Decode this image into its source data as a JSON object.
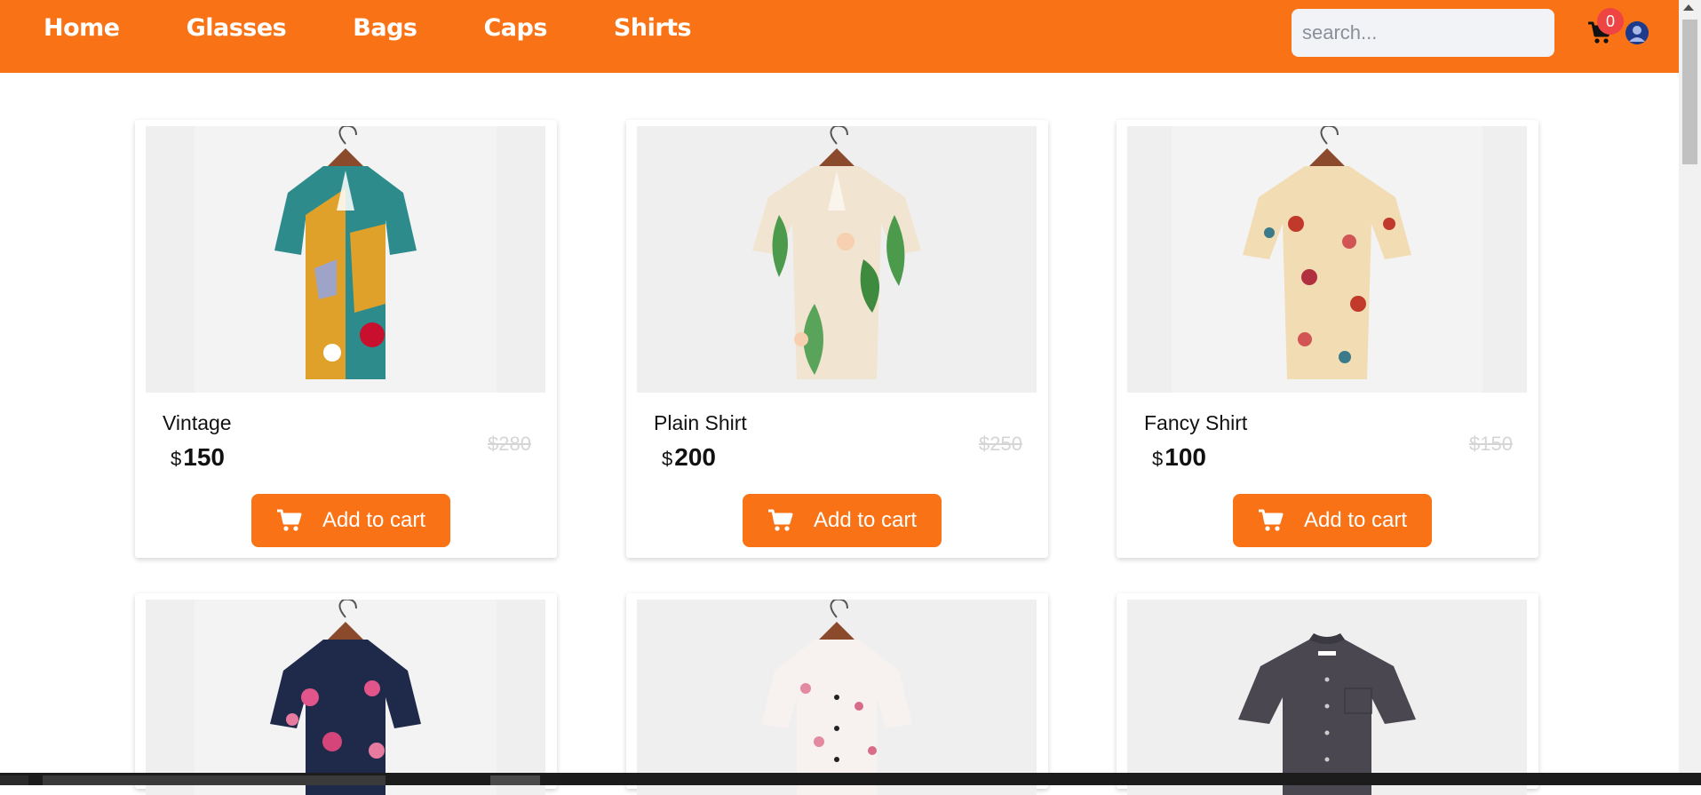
{
  "nav": {
    "links": [
      "Home",
      "Glasses",
      "Bags",
      "Caps",
      "Shirts"
    ]
  },
  "search": {
    "placeholder": "search..."
  },
  "cart": {
    "count": "0",
    "icon": "cart-icon"
  },
  "avatar": {
    "icon": "user-avatar-icon"
  },
  "products": [
    {
      "name": "Vintage",
      "currency": "$",
      "price": "150",
      "old_price": "$280",
      "button": "Add to cart",
      "pattern": "vintage"
    },
    {
      "name": "Plain Shirt",
      "currency": "$",
      "price": "200",
      "old_price": "$250",
      "button": "Add to cart",
      "pattern": "leaf"
    },
    {
      "name": "Fancy Shirt",
      "currency": "$",
      "price": "100",
      "old_price": "$150",
      "button": "Add to cart",
      "pattern": "floral"
    }
  ],
  "products_row2": [
    {
      "pattern": "navy-floral"
    },
    {
      "pattern": "pink-blossom"
    },
    {
      "pattern": "dark-plain"
    }
  ],
  "colors": {
    "accent": "#f97316",
    "badge": "#ef4444",
    "old_price": "#d5d5d5"
  }
}
